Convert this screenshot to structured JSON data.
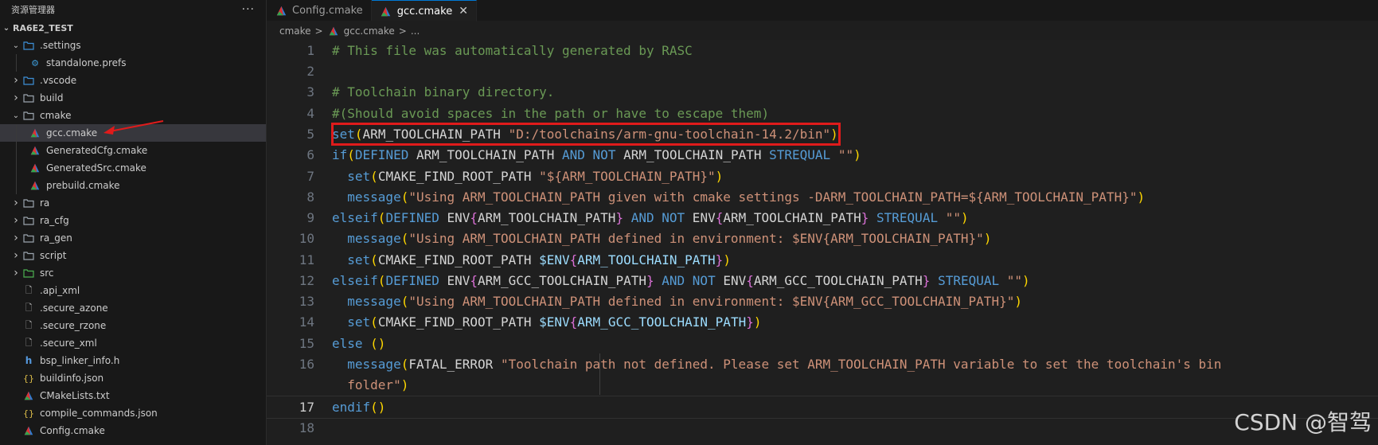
{
  "explorer": {
    "title": "资源管理器",
    "more": "···",
    "root": "RA6E2_TEST",
    "items": [
      {
        "label": ".settings",
        "type": "folder-open",
        "depth": 1
      },
      {
        "label": "standalone.prefs",
        "type": "gear",
        "depth": 2
      },
      {
        "label": ".vscode",
        "type": "folder",
        "depth": 1
      },
      {
        "label": "build",
        "type": "folder",
        "depth": 1
      },
      {
        "label": "cmake",
        "type": "folder-open",
        "depth": 1
      },
      {
        "label": "gcc.cmake",
        "type": "cmake",
        "depth": 2,
        "selected": true
      },
      {
        "label": "GeneratedCfg.cmake",
        "type": "cmake",
        "depth": 2
      },
      {
        "label": "GeneratedSrc.cmake",
        "type": "cmake",
        "depth": 2
      },
      {
        "label": "prebuild.cmake",
        "type": "cmake",
        "depth": 2
      },
      {
        "label": "ra",
        "type": "folder",
        "depth": 1
      },
      {
        "label": "ra_cfg",
        "type": "folder",
        "depth": 1
      },
      {
        "label": "ra_gen",
        "type": "folder",
        "depth": 1
      },
      {
        "label": "script",
        "type": "folder",
        "depth": 1
      },
      {
        "label": "src",
        "type": "folder",
        "depth": 1
      },
      {
        "label": ".api_xml",
        "type": "file",
        "depth": 1
      },
      {
        "label": ".secure_azone",
        "type": "file",
        "depth": 1
      },
      {
        "label": ".secure_rzone",
        "type": "file",
        "depth": 1
      },
      {
        "label": ".secure_xml",
        "type": "file",
        "depth": 1
      },
      {
        "label": "bsp_linker_info.h",
        "type": "h",
        "depth": 1
      },
      {
        "label": "buildinfo.json",
        "type": "json",
        "depth": 1
      },
      {
        "label": "CMakeLists.txt",
        "type": "cmake",
        "depth": 1
      },
      {
        "label": "compile_commands.json",
        "type": "json",
        "depth": 1
      },
      {
        "label": "Config.cmake",
        "type": "cmake",
        "depth": 1
      }
    ]
  },
  "tabs": [
    {
      "label": "Config.cmake",
      "active": false
    },
    {
      "label": "gcc.cmake",
      "active": true,
      "close": "✕"
    }
  ],
  "breadcrumb": {
    "part1": "cmake",
    "sep": ">",
    "part2": "gcc.cmake",
    "part3": "..."
  },
  "editor": {
    "current_line": 17
  },
  "watermark": "CSDN @智驾",
  "colors": {
    "highlight_box": "#e01b1b",
    "arrow": "#e01b1b",
    "cmake_icon": "#2f7dd1"
  }
}
